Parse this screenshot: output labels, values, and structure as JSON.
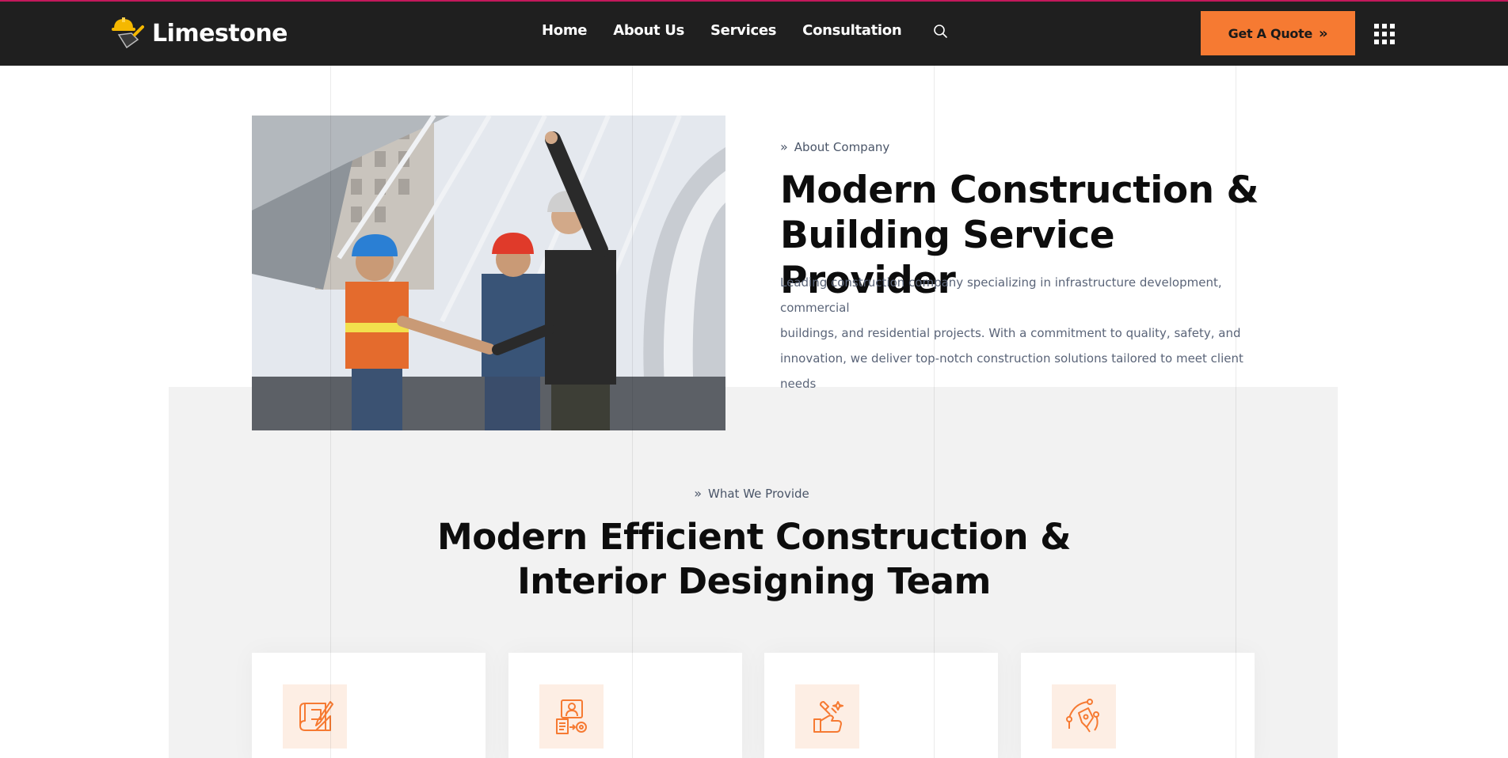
{
  "header": {
    "logo_text": "Limestone",
    "nav": [
      "Home",
      "About Us",
      "Services",
      "Consultation"
    ],
    "quote_button": "Get A Quote",
    "quote_arrow": "»"
  },
  "about": {
    "eyebrow": "About Company",
    "title_line1": "Modern Construction &",
    "title_line2": "Building Service Provider",
    "desc_line1": "Leading construction company specializing in infrastructure development, commercial",
    "desc_line2": "buildings, and residential projects. With a commitment to quality, safety, and",
    "desc_line3": "innovation, we deliver top-notch construction solutions tailored to meet client needs"
  },
  "provide": {
    "eyebrow": "What We Provide",
    "title_line1": "Modern Efficient Construction &",
    "title_line2": "Interior Designing Team"
  },
  "cards": [
    {
      "icon": "blueprint-icon"
    },
    {
      "icon": "engineer-gear-icon"
    },
    {
      "icon": "hand-tools-icon"
    },
    {
      "icon": "pen-tool-icon"
    }
  ],
  "colors": {
    "accent": "#f67a32",
    "navbar": "#1f1f1f",
    "icon_bg": "#fdeee4"
  }
}
